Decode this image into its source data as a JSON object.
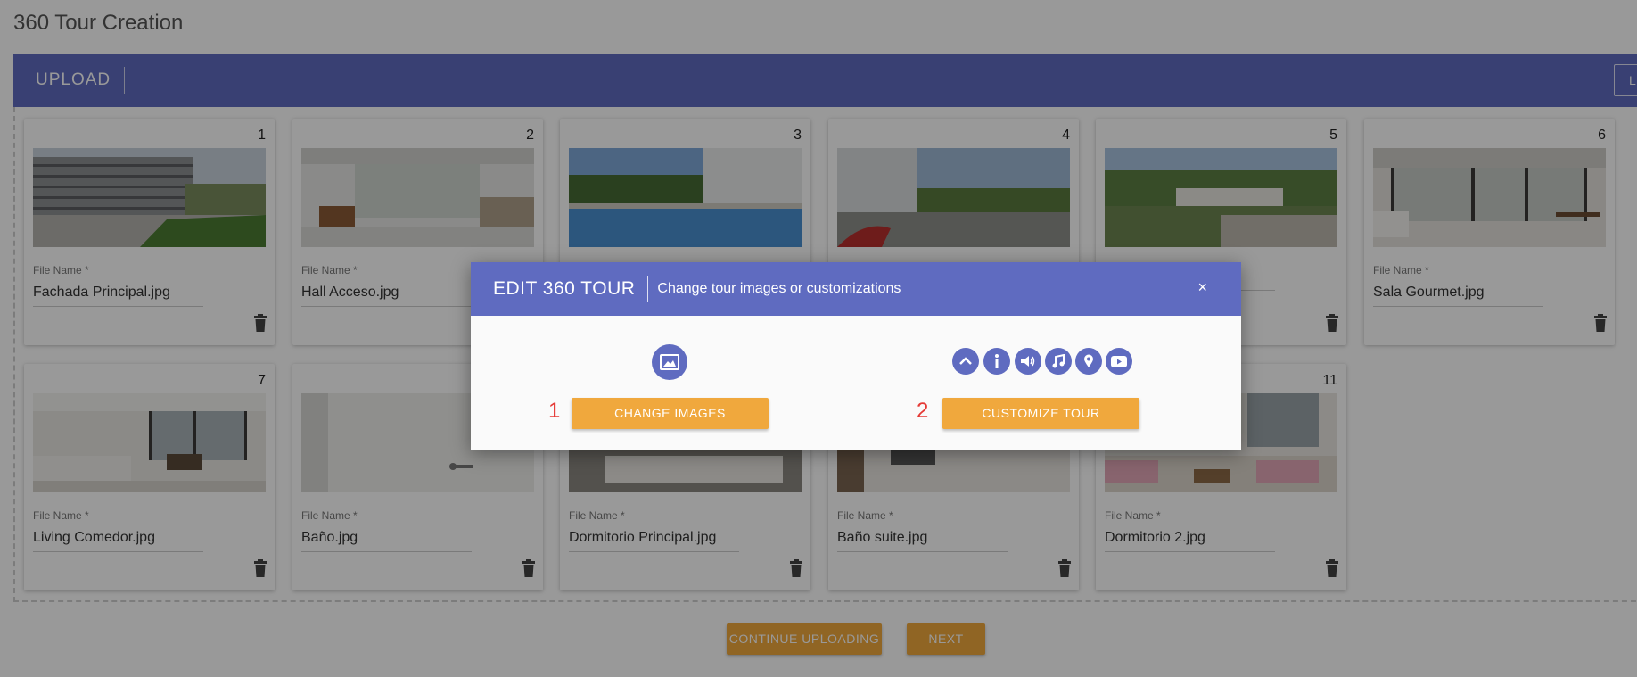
{
  "page": {
    "title": "360 Tour Creation"
  },
  "upload_bar": {
    "title": "UPLOAD",
    "learn_button": "LEA"
  },
  "cards": [
    {
      "number": "1",
      "file_label": "File Name",
      "file_name": "Fachada Principal.jpg",
      "thumb": "building"
    },
    {
      "number": "2",
      "file_label": "File Name",
      "file_name": "Hall Acceso.jpg",
      "thumb": "hall"
    },
    {
      "number": "3",
      "file_label": "",
      "file_name": "",
      "thumb": "pool"
    },
    {
      "number": "4",
      "file_label": "",
      "file_name": "",
      "thumb": "playground"
    },
    {
      "number": "5",
      "file_label": "",
      "file_name": "",
      "thumb": "garden"
    },
    {
      "number": "6",
      "file_label": "File Name",
      "file_name": "Sala Gourmet.jpg",
      "thumb": "gourmet"
    },
    {
      "number": "7",
      "file_label": "File Name",
      "file_name": "Living Comedor.jpg",
      "thumb": "living"
    },
    {
      "number": "",
      "file_label": "File Name",
      "file_name": "Baño.jpg",
      "thumb": "bath"
    },
    {
      "number": "",
      "file_label": "File Name",
      "file_name": "Dormitorio Principal.jpg",
      "thumb": "bedroom"
    },
    {
      "number": "",
      "file_label": "File Name",
      "file_name": "Baño suite.jpg",
      "thumb": "suite"
    },
    {
      "number": "11",
      "file_label": "File Name",
      "file_name": "Dormitorio 2.jpg",
      "thumb": "bedroom2"
    }
  ],
  "buttons": {
    "continue": "CONTINUE UPLOADING",
    "next": "NEXT"
  },
  "modal": {
    "title": "EDIT 360 TOUR",
    "subtitle": "Change tour images or customizations",
    "close": "×",
    "step1": "1",
    "step2": "2",
    "change_images": "CHANGE IMAGES",
    "customize_tour": "CUSTOMIZE TOUR",
    "custom_icons": [
      "chevron-up-icon",
      "info-icon",
      "volume-icon",
      "music-note-icon",
      "map-pin-icon",
      "youtube-icon"
    ]
  },
  "colors": {
    "primary": "#5f6bc0",
    "accent": "#f0a83d",
    "step_number": "#e53935"
  }
}
